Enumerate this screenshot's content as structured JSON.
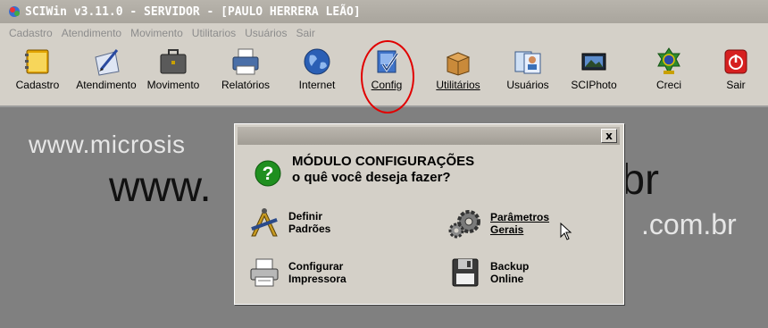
{
  "window": {
    "title": "SCIWin v3.11.0 - SERVIDOR - [PAULO HERRERA LEÃO]"
  },
  "menu": [
    "Cadastro",
    "Atendimento",
    "Movimento",
    "Utilitarios",
    "Usuários",
    "Sair"
  ],
  "toolbar": [
    {
      "label": "Cadastro",
      "icon": "address-book-icon"
    },
    {
      "label": "Atendimento",
      "icon": "pen-document-icon"
    },
    {
      "label": "Movimento",
      "icon": "briefcase-icon"
    },
    {
      "label": "Relatórios",
      "icon": "printer-icon"
    },
    {
      "label": "Internet",
      "icon": "globe-icon"
    },
    {
      "label": "Config",
      "icon": "config-check-icon"
    },
    {
      "label": "Utilitários",
      "icon": "box-icon"
    },
    {
      "label": "Usuários",
      "icon": "users-icon"
    },
    {
      "label": "SCIPhoto",
      "icon": "photo-icon"
    },
    {
      "label": "Creci",
      "icon": "emblem-icon"
    },
    {
      "label": "Sair",
      "icon": "power-icon"
    }
  ],
  "background": {
    "line1": "www.microsis",
    "line2": "www.",
    "right1": ".br",
    "right2": ".com.br"
  },
  "dialog": {
    "close_label": "x",
    "heading_line1": "MÓDULO CONFIGURAÇÕES",
    "heading_line2": "o quê você deseja fazer?",
    "options": [
      {
        "line1": "Definir",
        "line2": "Padrões",
        "icon": "compass-square-icon"
      },
      {
        "line1": "Parâmetros",
        "line2": "Gerais",
        "icon": "gears-icon"
      },
      {
        "line1": "Configurar",
        "line2": "Impressora",
        "icon": "printer-icon"
      },
      {
        "line1": "Backup",
        "line2": "Online",
        "icon": "floppy-disk-icon"
      }
    ]
  },
  "colors": {
    "highlight_circle": "#e10000",
    "desktop": "#808080",
    "chrome": "#d4d0c8"
  }
}
